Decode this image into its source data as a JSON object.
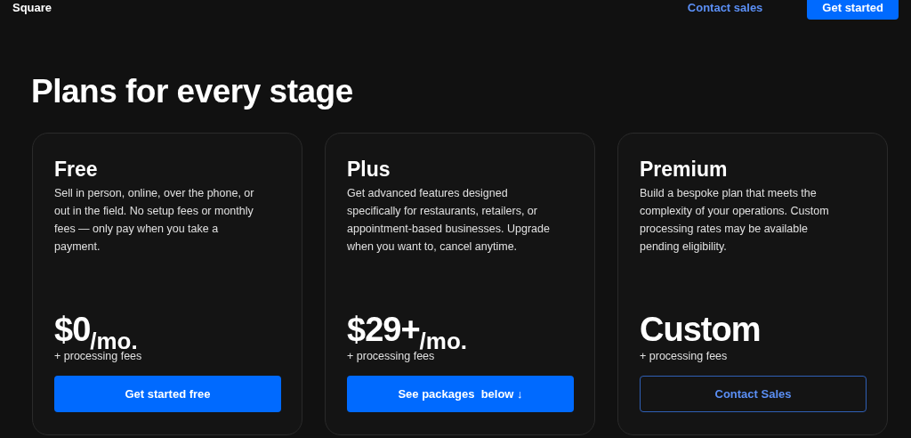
{
  "header": {
    "logo": "Square",
    "links": [
      {
        "label": "Contact sales",
        "kind": "link"
      },
      {
        "label": "Get started",
        "kind": "primary"
      }
    ]
  },
  "title": "Plans for every stage",
  "plans": [
    {
      "name": "Free",
      "description": "Sell in person, online, over the phone, or out in the field. No setup fees or monthly fees — only pay when you take a payment.",
      "price": "$0",
      "unit": "/mo.",
      "note": "+ processing fees",
      "button": {
        "label": "Get started free",
        "kind": "primary"
      }
    },
    {
      "name": "Plus",
      "description": "Get advanced features designed specifically for restaurants, retailers, or appointment-based businesses. Upgrade when you want to, cancel anytime.",
      "price": "$29+",
      "unit": "/mo.",
      "note": "+ processing fees",
      "button": {
        "label": "See packages  below ↓",
        "kind": "primary"
      }
    },
    {
      "name": "Premium",
      "description": "Build a bespoke plan that meets the complexity of your operations. Custom processing rates may be available pending eligibility.",
      "price": "Custom",
      "note": "+ processing fees",
      "button": {
        "label": "Contact Sales",
        "kind": "outline"
      }
    }
  ]
}
